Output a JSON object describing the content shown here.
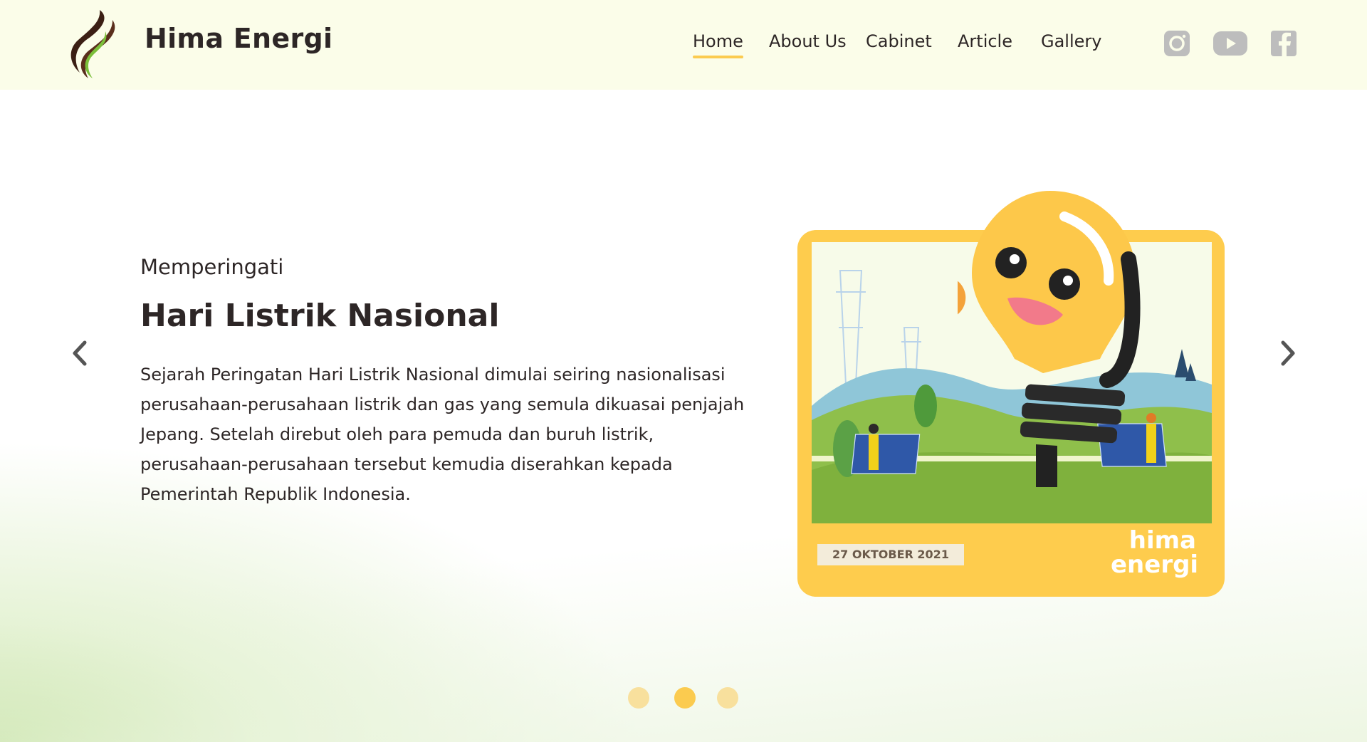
{
  "brand": {
    "name": "Hima Energi"
  },
  "nav": {
    "items": [
      {
        "label": "Home",
        "active": true
      },
      {
        "label": "About Us"
      },
      {
        "label": "Cabinet"
      },
      {
        "label": "Article"
      },
      {
        "label": "Gallery"
      }
    ]
  },
  "social": [
    {
      "icon": "instagram-icon"
    },
    {
      "icon": "youtube-icon"
    },
    {
      "icon": "facebook-icon"
    }
  ],
  "slide": {
    "eyebrow": "Memperingati",
    "title": "Hari Listrik Nasional",
    "description": "Sejarah Peringatan Hari Listrik Nasional dimulai seiring nasionalisasi perusahaan-perusahaan listrik dan gas yang semula dikuasai penjajah Jepang. Setelah direbut oleh para pemuda dan buruh listrik, perusahaan-perusahaan tersebut kemudia diserahkan kepada Pemerintah Republik Indonesia.",
    "card": {
      "date": "27 OKTOBER 2021",
      "brand_line1": "hima",
      "brand_line2": "energi"
    }
  },
  "carousel": {
    "slides": 3,
    "active_index": 1,
    "prev_icon": "chevron-left-icon",
    "next_icon": "chevron-right-icon"
  },
  "colors": {
    "header_bg": "#fbfde9",
    "accent": "#fbcb4f",
    "card_yellow": "#fecc4d",
    "text": "#2d2626",
    "icon_gray": "#bdbdbd"
  }
}
